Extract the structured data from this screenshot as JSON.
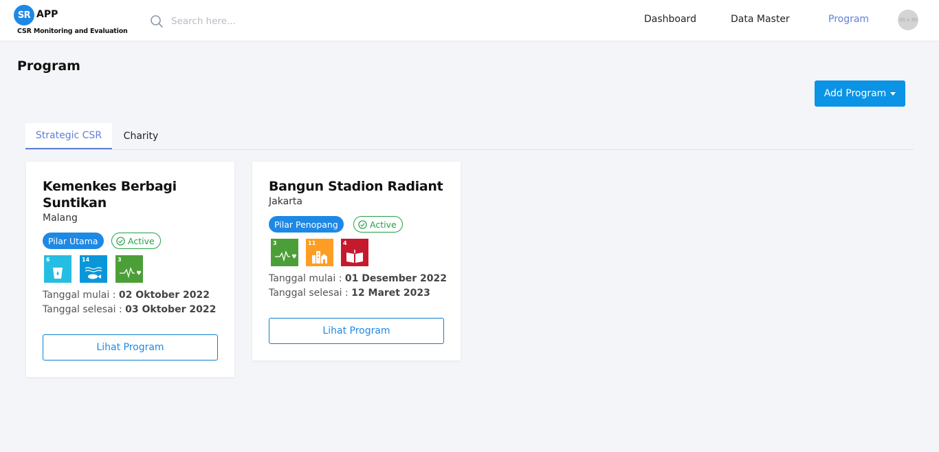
{
  "app": {
    "logo_badge": "SR",
    "logo_text": "APP",
    "tagline": "CSR Monitoring and Evaluation"
  },
  "search": {
    "placeholder": "Search here..."
  },
  "nav": {
    "items": [
      {
        "label": "Dashboard"
      },
      {
        "label": "Data Master"
      },
      {
        "label": "Program",
        "active": true
      }
    ],
    "avatar_label": "30 x 30"
  },
  "page": {
    "title": "Program",
    "add_button_label": "Add Program"
  },
  "tabs": [
    {
      "label": "Strategic CSR",
      "active": true
    },
    {
      "label": "Charity",
      "active": false
    }
  ],
  "colors": {
    "accent": "#5f7fd8",
    "primary_button": "#0b93e6",
    "pillar_badge": "#1e88e5",
    "active_status": "#22a045"
  },
  "programs": [
    {
      "title": "Kemenkes Berbagi Suntikan",
      "location": "Malang",
      "pillar": "Pilar Utama",
      "status": "Active",
      "sdgs": [
        {
          "number": "6",
          "icon": "water-drop-icon",
          "color": "#26bde2"
        },
        {
          "number": "14",
          "icon": "fish-icon",
          "color": "#0a97d9"
        },
        {
          "number": "3",
          "icon": "heartbeat-icon",
          "color": "#4c9f38"
        }
      ],
      "start_label": "Tanggal mulai : ",
      "start_date": "02 Oktober 2022",
      "end_label": "Tanggal selesai : ",
      "end_date": "03 Oktober 2022",
      "button_label": "Lihat Program"
    },
    {
      "title": "Bangun Stadion Radiant",
      "location": "Jakarta",
      "pillar": "Pilar Penopang",
      "status": "Active",
      "sdgs": [
        {
          "number": "3",
          "icon": "heartbeat-icon",
          "color": "#4c9f38"
        },
        {
          "number": "11",
          "icon": "city-icon",
          "color": "#fd9d24"
        },
        {
          "number": "4",
          "icon": "book-icon",
          "color": "#c5192d"
        }
      ],
      "start_label": "Tanggal mulai : ",
      "start_date": "01 Desember 2022",
      "end_label": "Tanggal selesai : ",
      "end_date": "12 Maret 2023",
      "button_label": "Lihat Program"
    }
  ]
}
